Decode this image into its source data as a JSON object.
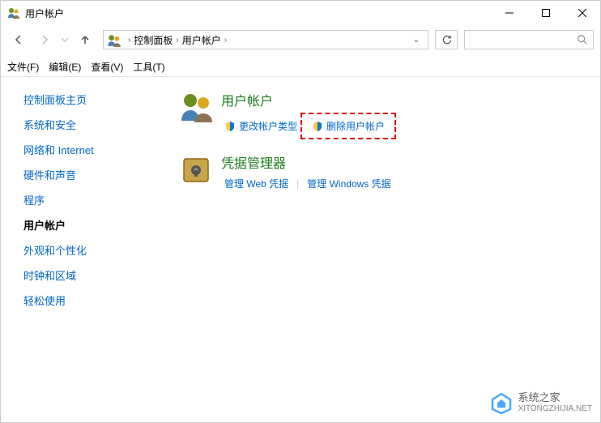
{
  "window": {
    "title": "用户帐户"
  },
  "breadcrumb": {
    "part1": "控制面板",
    "part2": "用户帐户"
  },
  "menu": {
    "file": "文件(F)",
    "edit": "编辑(E)",
    "view": "查看(V)",
    "tools": "工具(T)"
  },
  "sidebar": {
    "items": [
      {
        "label": "控制面板主页",
        "active": false
      },
      {
        "label": "系统和安全",
        "active": false
      },
      {
        "label": "网络和 Internet",
        "active": false
      },
      {
        "label": "硬件和声音",
        "active": false
      },
      {
        "label": "程序",
        "active": false
      },
      {
        "label": "用户帐户",
        "active": true
      },
      {
        "label": "外观和个性化",
        "active": false
      },
      {
        "label": "时钟和区域",
        "active": false
      },
      {
        "label": "轻松使用",
        "active": false
      }
    ]
  },
  "content": {
    "user_accounts": {
      "title": "用户帐户",
      "link_change_type": "更改帐户类型",
      "link_delete": "删除用户帐户"
    },
    "credential_manager": {
      "title": "凭据管理器",
      "link_web": "管理 Web 凭据",
      "link_windows": "管理 Windows 凭据"
    }
  },
  "watermark": {
    "name": "系统之家",
    "url": "XITONGZHIJIA.NET"
  }
}
